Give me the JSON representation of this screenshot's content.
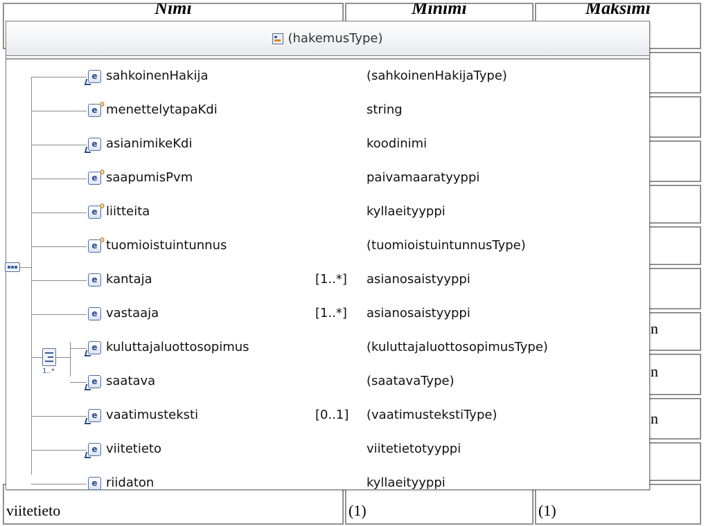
{
  "background_table": {
    "header": [
      "Nimi",
      "Minimi",
      "Maksimi"
    ],
    "last_row": [
      "viitetieto",
      "(1)",
      "(1)"
    ],
    "partial_right_text": "n"
  },
  "diagram": {
    "title": "(hakemusType)",
    "sequence_icon": "sequence-compositor-icon",
    "choice_icon": "choice-compositor-icon",
    "choice_cardinality": "1..*",
    "rows": [
      {
        "name": "sahkoinenHakija",
        "cardinality": "",
        "type": "(sahkoinenHakijaType)",
        "icon": "element-ref-icon"
      },
      {
        "name": "menettelytapaKdi",
        "cardinality": "",
        "type": "string",
        "icon": "element-optional-icon"
      },
      {
        "name": "asianimikeKdi",
        "cardinality": "",
        "type": "koodinimi",
        "icon": "element-ref-icon"
      },
      {
        "name": "saapumisPvm",
        "cardinality": "",
        "type": "paivamaaratyyppi",
        "icon": "element-optional-icon"
      },
      {
        "name": "liitteita",
        "cardinality": "",
        "type": "kyllaeityyppi",
        "icon": "element-optional-icon"
      },
      {
        "name": "tuomioistuintunnus",
        "cardinality": "",
        "type": "(tuomioistuintunnusType)",
        "icon": "element-optional-icon"
      },
      {
        "name": "kantaja",
        "cardinality": "[1..*]",
        "type": "asianosaistyyppi",
        "icon": "element-icon"
      },
      {
        "name": "vastaaja",
        "cardinality": "[1..*]",
        "type": "asianosaistyyppi",
        "icon": "element-icon"
      },
      {
        "name": "kuluttajaluottosopimus",
        "cardinality": "",
        "type": "(kuluttajaluottosopimusType)",
        "icon": "element-ref-icon"
      },
      {
        "name": "saatava",
        "cardinality": "",
        "type": "(saatavaType)",
        "icon": "element-ref-icon"
      },
      {
        "name": "vaatimusteksti",
        "cardinality": "[0..1]",
        "type": "(vaatimustekstiType)",
        "icon": "element-ref-icon"
      },
      {
        "name": "viitetieto",
        "cardinality": "",
        "type": "viitetietotyyppi",
        "icon": "element-ref-icon"
      },
      {
        "name": "riidaton",
        "cardinality": "",
        "type": "kyllaeityyppi",
        "icon": "element-icon"
      }
    ]
  }
}
